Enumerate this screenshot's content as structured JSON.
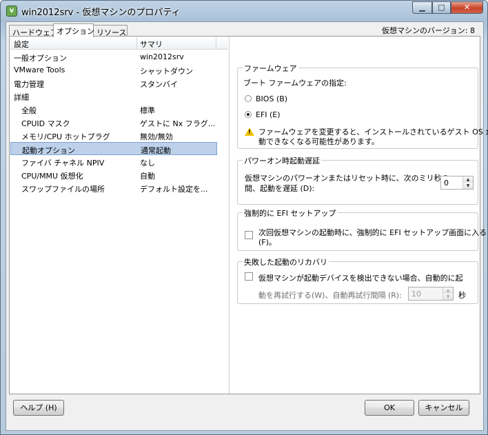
{
  "window": {
    "title": "win2012srv - 仮想マシンのプロパティ",
    "app_icon": "vsphere-icon",
    "controls": {
      "min": "▁",
      "max": "□",
      "close": "✕"
    }
  },
  "tabs": [
    {
      "label": "ハードウェア",
      "active": false
    },
    {
      "label": "オプション",
      "active": true
    },
    {
      "label": "リソース",
      "active": false
    }
  ],
  "vm_version": "仮想マシンのバージョン: 8",
  "list": {
    "headers": [
      "設定",
      "サマリ"
    ],
    "rows": [
      {
        "setting": "一般オプション",
        "summary": "win2012srv",
        "indent": false,
        "selected": false
      },
      {
        "setting": "VMware Tools",
        "summary": "シャットダウン",
        "indent": false,
        "selected": false
      },
      {
        "setting": "電力管理",
        "summary": "スタンバイ",
        "indent": false,
        "selected": false
      },
      {
        "setting": "詳細",
        "summary": "",
        "indent": false,
        "selected": false
      },
      {
        "setting": "全般",
        "summary": "標準",
        "indent": true,
        "selected": false
      },
      {
        "setting": "CPUID マスク",
        "summary": "ゲストに Nx フラグ...",
        "indent": true,
        "selected": false
      },
      {
        "setting": "メモリ/CPU ホットプラグ",
        "summary": "無効/無効",
        "indent": true,
        "selected": false
      },
      {
        "setting": "起動オプション",
        "summary": "通常起動",
        "indent": true,
        "selected": true
      },
      {
        "setting": "ファイバ チャネル NPIV",
        "summary": "なし",
        "indent": true,
        "selected": false
      },
      {
        "setting": "CPU/MMU 仮想化",
        "summary": "自動",
        "indent": true,
        "selected": false
      },
      {
        "setting": "スワップファイルの場所",
        "summary": "デフォルト設定を...",
        "indent": true,
        "selected": false
      }
    ]
  },
  "firmware": {
    "legend": "ファームウェア",
    "prompt": "ブート ファームウェアの指定:",
    "options": [
      "BIOS (B)",
      "EFI (E)"
    ],
    "selected": "EFI (E)",
    "warning_line1": "ファームウェアを変更すると、インストールされているゲスト OS が起",
    "warning_line2": "動できなくなる可能性があります。"
  },
  "power_on_delay": {
    "legend": "パワーオン時起動遅延",
    "text_line1": "仮想マシンのパワーオンまたはリセット時に、次のミリ秒の",
    "text_line2": "間、起動を遅延 (D):",
    "value": "0"
  },
  "efi_setup": {
    "legend": "強制的に EFI セットアップ",
    "text_line1": "次回仮想マシンの起動時に、強制的に EFI セットアップ画面に入る",
    "text_line2": "(F)。",
    "checked": false
  },
  "failed_boot_recovery": {
    "legend": "失敗した起動のリカバリ",
    "text_line1": "仮想マシンが起動デバイスを検出できない場合、自動的に起",
    "text_line2": "動を再試行する(W)、自動再試行間隔 (R):",
    "value": "10",
    "unit": "秒",
    "checked": false
  },
  "buttons": {
    "help": "ヘルプ (H)",
    "ok": "OK",
    "cancel": "キャンセル"
  }
}
